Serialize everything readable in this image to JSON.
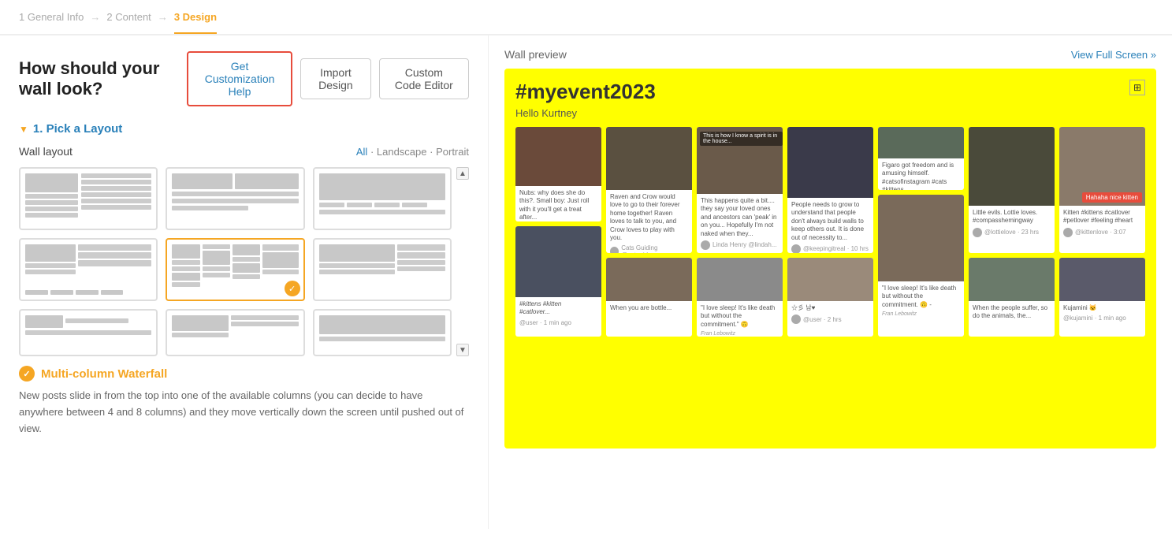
{
  "breadcrumb": {
    "steps": [
      {
        "id": 1,
        "label": "General Info",
        "active": false
      },
      {
        "id": 2,
        "label": "Content",
        "active": false
      },
      {
        "id": 3,
        "label": "Design",
        "active": true
      }
    ],
    "arrow": "→"
  },
  "header": {
    "title": "How should your wall look?",
    "get_customization_label": "Get Customization Help",
    "import_design_label": "Import Design",
    "custom_code_label": "Custom Code Editor"
  },
  "layout_section": {
    "section_title": "1. Pick a Layout",
    "wall_layout_label": "Wall layout",
    "filters": {
      "all": "All",
      "landscape": "Landscape",
      "portrait": "Portrait",
      "separator": " · "
    },
    "selected_name": "Multi-column Waterfall",
    "selected_desc": "New posts slide in from the top into one of the available columns (you can decide to have anywhere between 4 and 8 columns) and they move vertically down the screen until pushed out of view."
  },
  "preview": {
    "title": "Wall preview",
    "view_fullscreen": "View Full Screen »",
    "event_title": "#myevent2023",
    "subtitle": "Hello Kurtney",
    "expand_icon": "⊞"
  },
  "colors": {
    "accent_orange": "#f5a623",
    "accent_blue": "#2980b9",
    "red_border": "#e74c3c",
    "wall_bg": "#ffff00"
  }
}
